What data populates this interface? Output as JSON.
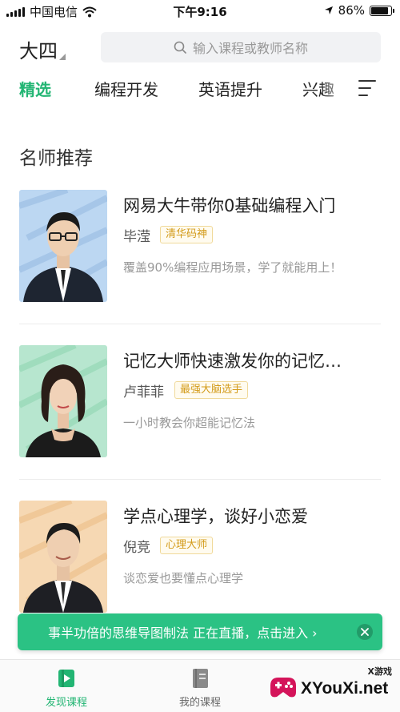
{
  "status_bar": {
    "carrier": "中国电信",
    "time": "下午9:16",
    "battery_percent": "86%",
    "battery_level": 0.86
  },
  "header": {
    "grade": "大四",
    "search_placeholder": "输入课程或教师名称"
  },
  "tabs": [
    {
      "label": "精选",
      "active": true
    },
    {
      "label": "编程开发",
      "active": false
    },
    {
      "label": "英语提升",
      "active": false
    },
    {
      "label": "兴趣",
      "active": false
    }
  ],
  "section": {
    "title": "名师推荐"
  },
  "courses": [
    {
      "title": "网易大牛带你0基础编程入门",
      "teacher": "毕滢",
      "tag": "清华码神",
      "desc": "覆盖90%编程应用场景，学了就能用上！"
    },
    {
      "title": "记忆大师快速激发你的记忆…",
      "teacher": "卢菲菲",
      "tag": "最强大脑选手",
      "desc": "一小时教会你超能记忆法"
    },
    {
      "title": "学点心理学，谈好小恋爱",
      "teacher": "倪竞",
      "tag": "心理大师",
      "desc": "谈恋爱也要懂点心理学"
    }
  ],
  "live_banner": {
    "text": "事半功倍的思维导图制法 正在直播，点击进入 ›"
  },
  "bottom_nav": [
    {
      "label": "发现课程",
      "icon": "play-icon",
      "active": true
    },
    {
      "label": "我的课程",
      "icon": "book-icon",
      "active": false
    }
  ],
  "watermark": {
    "top": "X游戏",
    "main": "XYouXi.net"
  },
  "colors": {
    "accent": "#22b573",
    "banner": "#2bc284",
    "tag_text": "#d39b1a"
  }
}
